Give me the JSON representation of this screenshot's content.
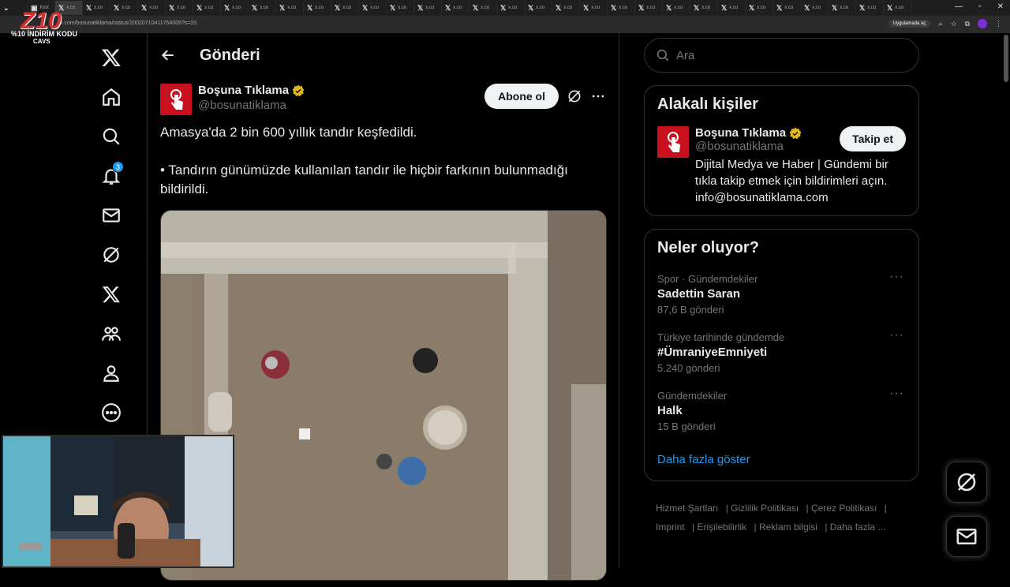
{
  "browser": {
    "tabs": [
      {
        "label": "Kick"
      },
      {
        "label": "x.co"
      },
      {
        "label": "x.co"
      },
      {
        "label": "x.co"
      },
      {
        "label": "x.co"
      },
      {
        "label": "x.co"
      },
      {
        "label": "x.co"
      },
      {
        "label": "x.co"
      },
      {
        "label": "x.co"
      },
      {
        "label": "x.co"
      },
      {
        "label": "x.co"
      },
      {
        "label": "x.co"
      },
      {
        "label": "x.co"
      },
      {
        "label": "x.co"
      },
      {
        "label": "x.co"
      },
      {
        "label": "x.co"
      },
      {
        "label": "x.co"
      },
      {
        "label": "x.co"
      },
      {
        "label": "x.co"
      },
      {
        "label": "x.co"
      },
      {
        "label": "x.co"
      },
      {
        "label": "x.co"
      },
      {
        "label": "x.co"
      },
      {
        "label": "x.co"
      },
      {
        "label": "x.co"
      },
      {
        "label": "x.co"
      },
      {
        "label": "x.co"
      },
      {
        "label": "x.co"
      },
      {
        "label": "x.co"
      },
      {
        "label": "x.co"
      },
      {
        "label": "x.co"
      },
      {
        "label": "x.co"
      }
    ],
    "url": "x.com/bosunatiklama/status/20020710411754005?s=20",
    "apps_pill": "Uygulamada aç"
  },
  "overlay": {
    "logo": "Z10",
    "promo": "%10 İNDİRİM KODU",
    "code": "CAVS"
  },
  "nav": {
    "notification_count": "3"
  },
  "header": {
    "title": "Gönderi"
  },
  "tweet": {
    "author_name": "Boşuna Tıklama",
    "handle": "@bosunatiklama",
    "subscribe_label": "Abone ol",
    "text_line1": "Amasya'da 2 bin 600 yıllık tandır keşfedildi.",
    "text_line2": "• Tandırın günümüzde kullanılan tandır ile hiçbir farkının bulunmadığı bildirildi."
  },
  "search": {
    "placeholder": "Ara"
  },
  "related": {
    "title": "Alakalı kişiler",
    "name": "Boşuna Tıklama",
    "handle": "@bosunatiklama",
    "follow_label": "Takip et",
    "bio": "Dijital Medya ve Haber | Gündemi bir tıkla takip etmek için bildirimleri açın. info@bosunatiklama.com"
  },
  "trends": {
    "title": "Neler oluyor?",
    "items": [
      {
        "meta": "Spor · Gündemdekiler",
        "title": "Sadettin Saran",
        "count": "87,6 B gönderi"
      },
      {
        "meta": "Türkiye tarihinde gündemde",
        "title": "#ÜmraniyeEmniyeti",
        "count": "5.240 gönderi"
      },
      {
        "meta": "Gündemdekiler",
        "title": "Halk",
        "count": "15 B gönderi"
      }
    ],
    "show_more": "Daha fazla göster"
  },
  "footer": {
    "links": [
      "Hizmet Şartları",
      "Gizlilik Politikası",
      "Çerez Politikası",
      "Imprint",
      "Erişilebilirlik",
      "Reklam bilgisi",
      "Daha fazla ..."
    ]
  },
  "colors": {
    "accent": "#1d9bf0",
    "brand_red": "#c8101e",
    "verified_gold": "#e2b719"
  }
}
